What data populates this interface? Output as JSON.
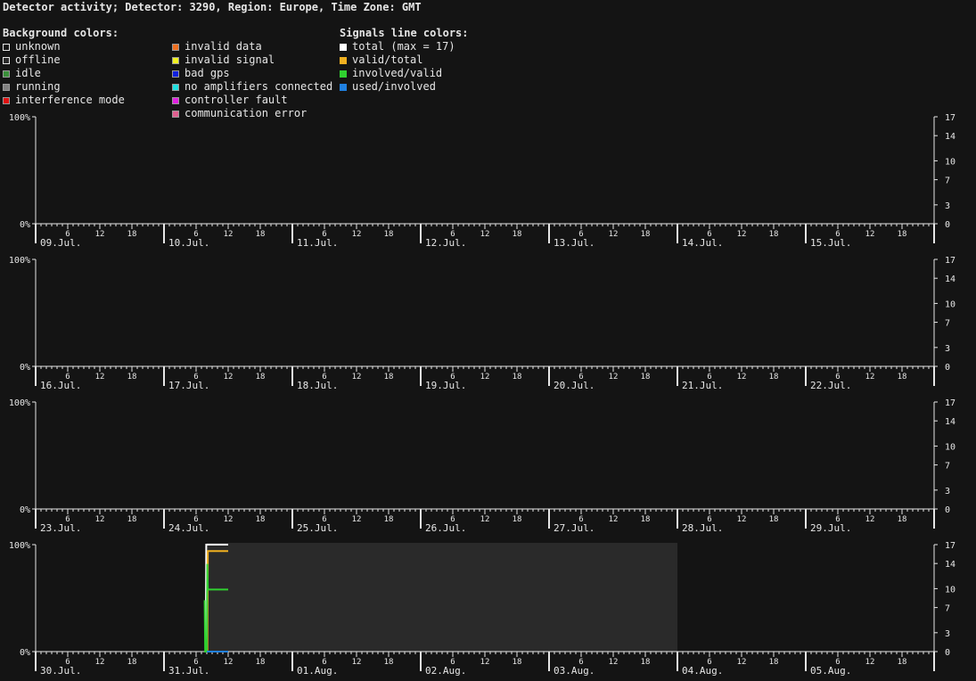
{
  "title": "Detector activity; Detector: 3290, Region: Europe, Time Zone: GMT",
  "legend": {
    "background_heading": "Background colors:",
    "signals_heading": "Signals line colors:",
    "background_col1": [
      {
        "label": "unknown",
        "color": "#141414",
        "border": "#e6e6e6"
      },
      {
        "label": "offline",
        "color": "#2a2a2a",
        "border": "#e6e6e6"
      },
      {
        "label": "idle",
        "color": "#3a8f3a",
        "border": "#9a9a9a"
      },
      {
        "label": "running",
        "color": "#808080",
        "border": "#9a9a9a"
      },
      {
        "label": "interference mode",
        "color": "#e01010",
        "border": "#9a9a9a"
      }
    ],
    "background_col2": [
      {
        "label": "invalid data",
        "color": "#f07020",
        "border": "#9a9a9a"
      },
      {
        "label": "invalid signal",
        "color": "#f0f020",
        "border": "#9a9a9a"
      },
      {
        "label": "bad gps",
        "color": "#1020e0",
        "border": "#9a9a9a"
      },
      {
        "label": "no amplifiers connected",
        "color": "#20e0e0",
        "border": "#9a9a9a"
      },
      {
        "label": "controller fault",
        "color": "#e020e0",
        "border": "#9a9a9a"
      },
      {
        "label": "communication error",
        "color": "#e06090",
        "border": "#9a9a9a"
      }
    ],
    "signals": [
      {
        "label": "total (max = 17)",
        "color": "#ffffff"
      },
      {
        "label": "valid/total",
        "color": "#f0b020"
      },
      {
        "label": "involved/valid",
        "color": "#30d030"
      },
      {
        "label": "used/involved",
        "color": "#2080e0"
      }
    ]
  },
  "chart_data": [
    {
      "type": "line",
      "days": [
        "09.Jul.",
        "10.Jul.",
        "11.Jul.",
        "12.Jul.",
        "13.Jul.",
        "14.Jul.",
        "15.Jul."
      ],
      "hour_ticks": [
        "6",
        "12",
        "18"
      ],
      "left_axis": {
        "labels": [
          "100%",
          "0%"
        ],
        "ylim": [
          0,
          100
        ]
      },
      "right_axis": {
        "ticks": [
          17,
          14,
          10,
          7,
          3,
          0
        ],
        "ylim": [
          0,
          17
        ]
      },
      "background_segments": [],
      "series": []
    },
    {
      "type": "line",
      "days": [
        "16.Jul.",
        "17.Jul.",
        "18.Jul.",
        "19.Jul.",
        "20.Jul.",
        "21.Jul.",
        "22.Jul."
      ],
      "hour_ticks": [
        "6",
        "12",
        "18"
      ],
      "left_axis": {
        "labels": [
          "100%",
          "0%"
        ],
        "ylim": [
          0,
          100
        ]
      },
      "right_axis": {
        "ticks": [
          17,
          14,
          10,
          7,
          3,
          0
        ],
        "ylim": [
          0,
          17
        ]
      },
      "background_segments": [],
      "series": []
    },
    {
      "type": "line",
      "days": [
        "23.Jul.",
        "24.Jul.",
        "25.Jul.",
        "26.Jul.",
        "27.Jul.",
        "28.Jul.",
        "29.Jul."
      ],
      "hour_ticks": [
        "6",
        "12",
        "18"
      ],
      "left_axis": {
        "labels": [
          "100%",
          "0%"
        ],
        "ylim": [
          0,
          100
        ]
      },
      "right_axis": {
        "ticks": [
          17,
          14,
          10,
          7,
          3,
          0
        ],
        "ylim": [
          0,
          17
        ]
      },
      "background_segments": [],
      "series": []
    },
    {
      "type": "line",
      "days": [
        "30.Jul.",
        "31.Jul.",
        "01.Aug.",
        "02.Aug.",
        "03.Aug.",
        "04.Aug.",
        "05.Aug."
      ],
      "hour_ticks": [
        "6",
        "12",
        "18"
      ],
      "left_axis": {
        "labels": [
          "100%",
          "0%"
        ],
        "ylim": [
          0,
          100
        ]
      },
      "right_axis": {
        "ticks": [
          17,
          14,
          10,
          7,
          3,
          0
        ],
        "ylim": [
          0,
          17
        ]
      },
      "background_segments": [
        {
          "state": "offline",
          "color": "#2a2a2a",
          "start_day": 1,
          "start_hour": 8,
          "end_day": 5,
          "end_hour": 0
        }
      ],
      "series": [
        {
          "color": "#ffffff",
          "points": [
            [
              1,
              7.8,
              0
            ],
            [
              1,
              7.9,
              100
            ],
            [
              1,
              12,
              100
            ]
          ]
        },
        {
          "color": "#f0b020",
          "points": [
            [
              1,
              8.1,
              0
            ],
            [
              1,
              8.2,
              94
            ],
            [
              1,
              12,
              94
            ]
          ]
        },
        {
          "color": "#30d030",
          "points": [
            [
              1,
              7.6,
              48
            ],
            [
              1,
              7.7,
              0
            ],
            [
              1,
              8.0,
              0
            ],
            [
              1,
              8.1,
              82
            ],
            [
              1,
              8.2,
              58
            ],
            [
              1,
              12,
              58
            ]
          ]
        },
        {
          "color": "#2080e0",
          "points": [
            [
              1,
              8.0,
              0
            ],
            [
              1,
              12,
              0
            ]
          ]
        }
      ]
    }
  ]
}
